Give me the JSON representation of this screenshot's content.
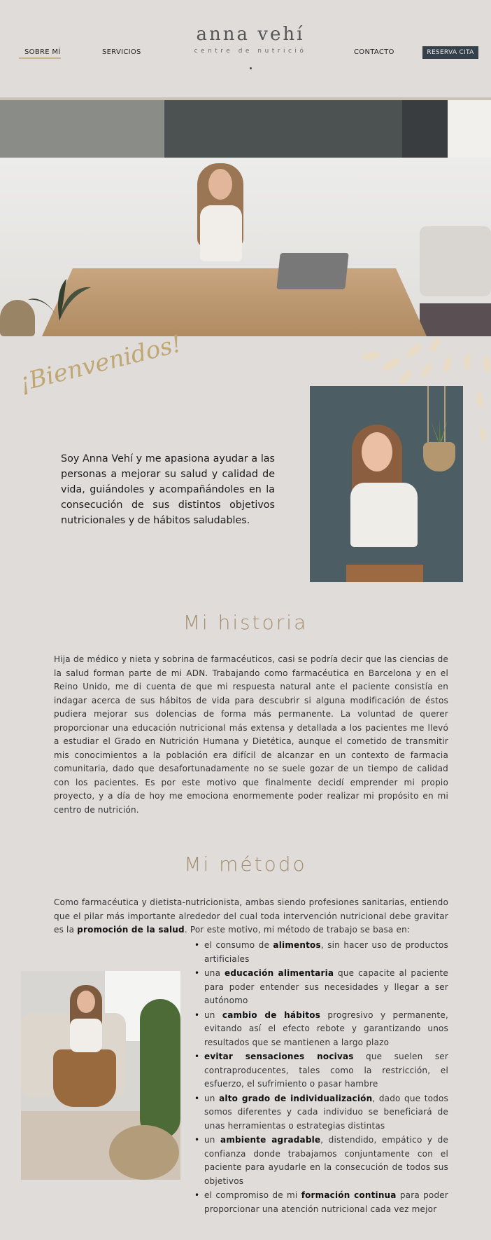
{
  "header": {
    "nav": {
      "about": "SOBRE MÍ",
      "services": "SERVICIOS",
      "contact": "CONTACTO"
    },
    "reserve_button": "RESERVA CITA",
    "logo": {
      "title": "anna vehí",
      "subtitle": "centre de nutrició"
    }
  },
  "welcome": {
    "script_title": "¡Bienvenidos!",
    "intro": "Soy Anna Vehí y me apasiona ayudar a las personas a mejorar su salud y calidad de vida, guiándoles y acompañándoles en la consecución de sus distintos objetivos nutricionales y de hábitos saludables."
  },
  "history": {
    "title": "Mi historia",
    "text": "Hija de médico y nieta y sobrina de farmacéuticos, casi se podría decir que las ciencias de la salud forman parte de mi ADN. Trabajando como farmacéutica en Barcelona y en el Reino Unido, me di cuenta de que mi respuesta natural ante el paciente consistía en indagar acerca de sus hábitos de vida para descubrir si alguna modificación de éstos pudiera mejorar sus dolencias de forma más permanente. La voluntad de querer proporcionar una educación nutricional más extensa y detallada a los pacientes me llevó a estudiar el Grado en Nutrición Humana y Dietética, aunque el cometido de transmitir mis conocimientos a la población era difícil de alcanzar en un contexto de farmacia comunitaria, dado que desafortunadamente no se suele gozar de un tiempo de calidad con los pacientes. Es por este motivo que finalmente decidí emprender mi propio proyecto, y a día de hoy me emociona enormemente poder realizar mi propósito en mi centro de nutrición."
  },
  "method": {
    "title": "Mi método",
    "intro_before": "Como farmacéutica y dietista-nutricionista, ambas siendo profesiones sanitarias, entiendo que el pilar más importante alrededor del cual toda intervención nutricional debe gravitar es la ",
    "intro_bold": "promoción de la salud",
    "intro_after": ". Por este motivo, mi método de trabajo se basa en:",
    "items": [
      {
        "pre": "el consumo de ",
        "bold": "alimentos",
        "post": ", sin hacer uso de productos artificiales"
      },
      {
        "pre": "una ",
        "bold": "educación alimentaria",
        "post": " que capacite al paciente para poder entender sus necesidades y llegar a ser autónomo"
      },
      {
        "pre": "un ",
        "bold": "cambio de hábitos",
        "post": " progresivo y permanente, evitando así el efecto rebote y garantizando unos resultados que se mantienen a largo plazo"
      },
      {
        "pre": "",
        "bold": "evitar sensaciones nocivas",
        "post": " que suelen ser contraproducentes, tales como la restricción, el esfuerzo, el sufrimiento o pasar hambre"
      },
      {
        "pre": "un ",
        "bold": "alto grado de individualización",
        "post": ", dado que todos somos diferentes y cada individuo se beneficiará de unas herramientas o estrategias distintas"
      },
      {
        "pre": "un ",
        "bold": "ambiente agradable",
        "post": ", distendido, empático y de confianza donde trabajamos conjuntamente con el paciente para ayudarle en la consecución de todos sus objetivos"
      },
      {
        "pre": "el compromiso de mi ",
        "bold": "formación continua",
        "post": " para poder proporcionar una atención nutricional cada vez mejor"
      }
    ]
  }
}
